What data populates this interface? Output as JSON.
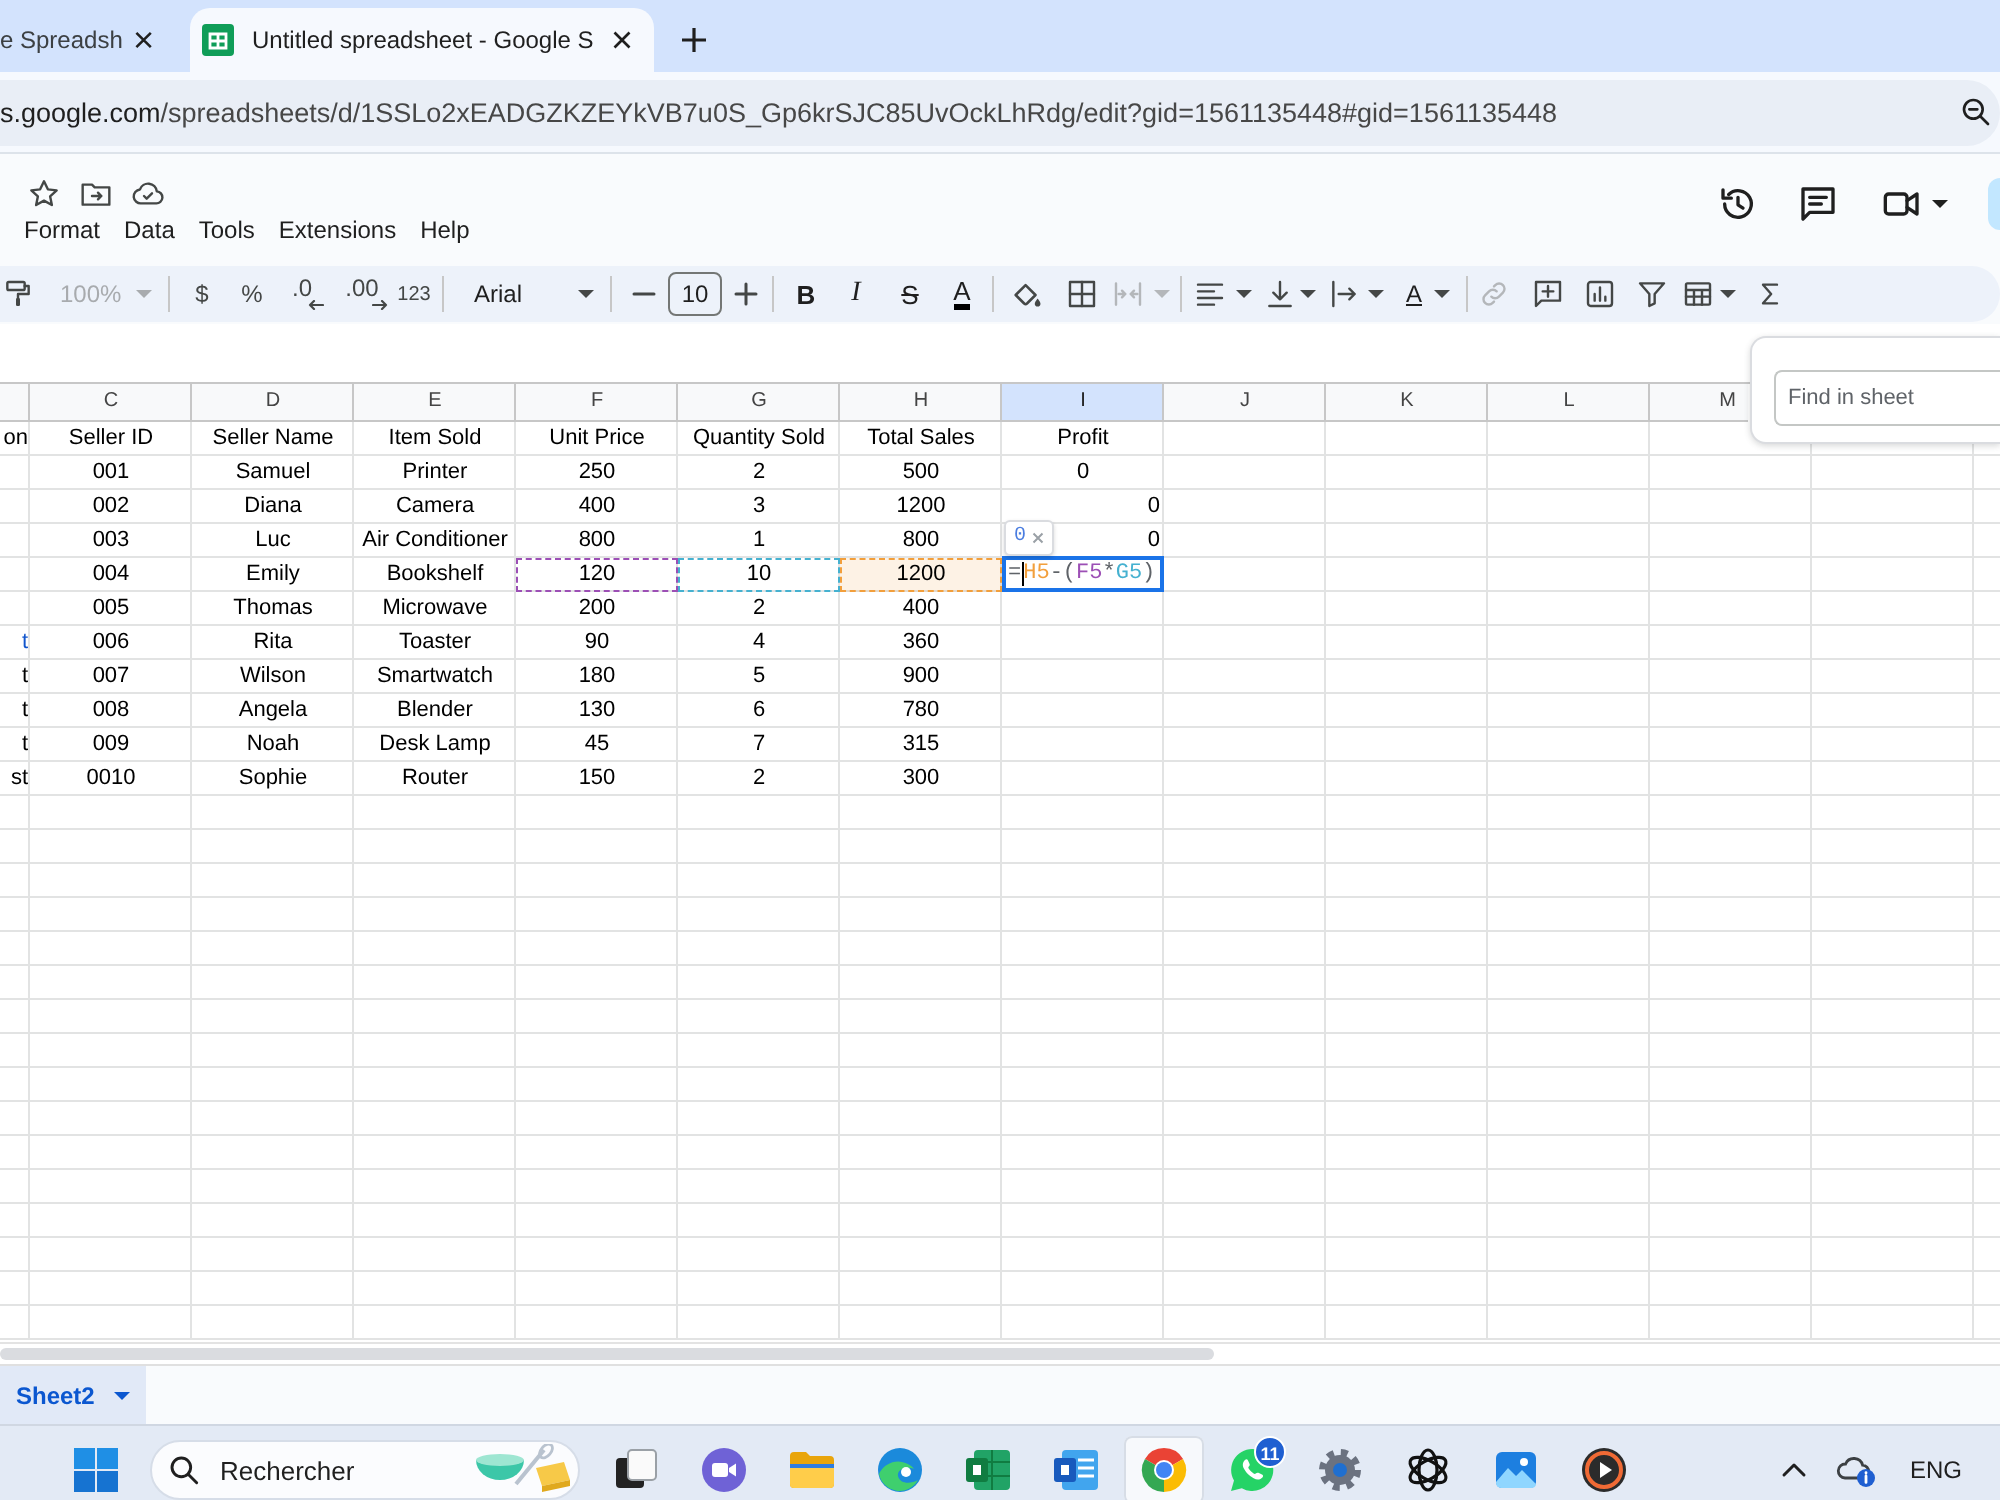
{
  "browser": {
    "tabs": [
      {
        "title": "e Spreadsh",
        "selected": false,
        "favicon": false
      },
      {
        "title": "Untitled spreadsheet - Google S",
        "selected": true,
        "favicon": true
      }
    ],
    "address": {
      "host": "s.google.com",
      "path": "/spreadsheets/d/1SSLo2xEADGZKZEYkVB7u0S_Gp6krSJC85UvOckLhRdg/edit?gid=1561135448#gid=1561135448"
    }
  },
  "menu": [
    "Format",
    "Data",
    "Tools",
    "Extensions",
    "Help"
  ],
  "toolbar": {
    "zoom": {
      "label": "100%",
      "disabled": true
    },
    "currency": "$",
    "percent": "%",
    "decrease_decimals": ".0",
    "increase_decimals": ".00",
    "number_format": "123",
    "font": "Arial",
    "font_size": "10",
    "bold": "B",
    "italic": "I",
    "strikethrough": "S",
    "text_color": "A",
    "merge_cells": {
      "disabled": true
    },
    "text_rotation": "A",
    "insert_link": {
      "disabled": true
    }
  },
  "sheet": {
    "columns": [
      {
        "label": "C",
        "selected": false
      },
      {
        "label": "D",
        "selected": false
      },
      {
        "label": "E",
        "selected": false
      },
      {
        "label": "F",
        "selected": false
      },
      {
        "label": "G",
        "selected": false
      },
      {
        "label": "H",
        "selected": false
      },
      {
        "label": "I",
        "selected": true
      },
      {
        "label": "J",
        "selected": false
      },
      {
        "label": "K",
        "selected": false
      },
      {
        "label": "L",
        "selected": false
      },
      {
        "label": "M",
        "selected": false
      }
    ],
    "rows": [
      {
        "cut_off": "on",
        "cells": [
          "Seller ID",
          "Seller Name",
          "Item Sold",
          "Unit Price",
          "Quantity Sold",
          "Total Sales",
          "Profit"
        ]
      },
      {
        "cells": [
          "001",
          "Samuel",
          "Printer",
          "250",
          "2",
          "500",
          "0"
        ]
      },
      {
        "cells": [
          "002",
          "Diana",
          "Camera",
          "400",
          "3",
          "1200",
          {
            "kind": "number",
            "text": "0"
          }
        ]
      },
      {
        "cells": [
          "003",
          "Luc",
          "Air Conditioner",
          "800",
          "1",
          "800",
          {
            "kind": "number",
            "text": "0"
          }
        ]
      },
      {
        "cells": [
          "004",
          "Emily",
          "Bookshelf",
          {
            "kind": "text",
            "text": "120",
            "color": "#9c4fb5",
            "active": false
          },
          {
            "kind": "text",
            "text": "10",
            "color": "#45b1d0",
            "active": false
          },
          {
            "kind": "text",
            "text": "1200",
            "color": "#f29f3c",
            "active": true
          },
          {
            "kind": "editor",
            "tokens": [
              {
                "text": "=",
                "cursor": true
              },
              {
                "text": "H5",
                "color": "#f29f3c",
                "cursor": false
              },
              {
                "text": "-",
                "cursor": false
              },
              {
                "text": "(",
                "cursor": false
              },
              {
                "text": "F5",
                "color": "#9c4fb5",
                "cursor": false
              },
              {
                "text": "*",
                "cursor": false
              },
              {
                "text": "G5",
                "color": "#45b1d0",
                "cursor": false
              },
              {
                "text": ")",
                "cursor": false
              }
            ],
            "result": "0"
          }
        ]
      },
      {
        "cells": [
          "005",
          "Thomas",
          "Microwave",
          "200",
          "2",
          "400"
        ]
      },
      {
        "cut_off": {
          "text": "t",
          "kind": "link"
        },
        "cells": [
          "006",
          "Rita",
          "Toaster",
          "90",
          "4",
          "360"
        ]
      },
      {
        "cut_off": "t",
        "cells": [
          "007",
          "Wilson",
          "Smartwatch",
          "180",
          "5",
          "900"
        ]
      },
      {
        "cut_off": "t",
        "cells": [
          "008",
          "Angela",
          "Blender",
          "130",
          "6",
          "780"
        ]
      },
      {
        "cut_off": "t",
        "cells": [
          "009",
          "Noah",
          "Desk Lamp",
          "45",
          "7",
          "315"
        ]
      },
      {
        "cut_off": "st",
        "cells": [
          "0010",
          "Sophie",
          "Router",
          "150",
          "2",
          "300"
        ]
      }
    ]
  },
  "find_panel": {
    "placeholder": "Find in sheet"
  },
  "sheet_tabs": [
    {
      "label": "Sheet2",
      "selected": true
    }
  ],
  "taskbar": {
    "search": {
      "placeholder": "Rechercher"
    },
    "apps": [
      {
        "selected": false
      },
      {
        "selected": false
      },
      {
        "selected": false
      },
      {
        "selected": false
      },
      {
        "selected": false
      },
      {
        "selected": false
      },
      {
        "selected": true
      },
      {
        "selected": false,
        "badge": "11"
      },
      {
        "selected": false
      },
      {
        "selected": false
      },
      {
        "selected": false
      },
      {
        "selected": false
      }
    ],
    "tray": {
      "language": "ENG"
    }
  }
}
